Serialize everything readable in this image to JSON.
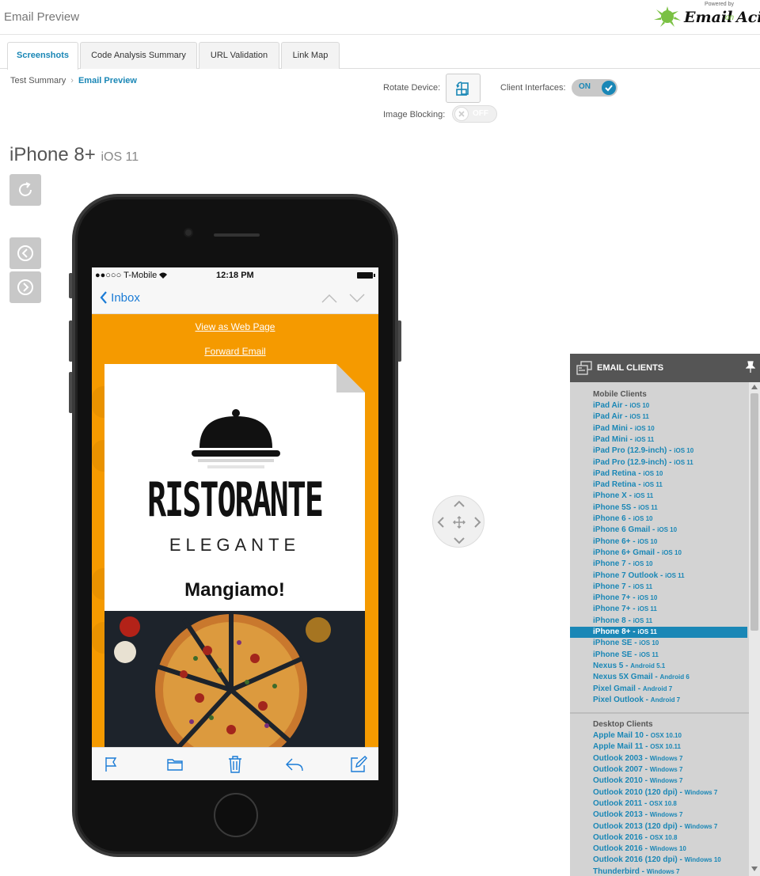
{
  "header": {
    "title": "Email Preview",
    "brand_powered": "Powered by",
    "brand_email": "Email",
    "brand_on": "on",
    "brand_acid": "Acid"
  },
  "tabs": [
    {
      "label": "Screenshots",
      "active": true
    },
    {
      "label": "Code Analysis Summary",
      "active": false
    },
    {
      "label": "URL Validation",
      "active": false
    },
    {
      "label": "Link Map",
      "active": false
    }
  ],
  "breadcrumb": {
    "parent": "Test Summary",
    "current": "Email Preview"
  },
  "controls": {
    "rotate_label": "Rotate Device:",
    "client_interfaces_label": "Client Interfaces:",
    "client_interfaces_state": "ON",
    "image_blocking_label": "Image Blocking:",
    "image_blocking_state": "OFF"
  },
  "device": {
    "name": "iPhone 8+",
    "os": "iOS 11"
  },
  "phone": {
    "carrier": "●●○○○ T-Mobile",
    "time": "12:18 PM",
    "back_label": "Inbox",
    "view_web": "View as Web Page",
    "forward": "Forward Email",
    "brand_main": "RISTORANTE",
    "brand_sub": "ELEGANTE",
    "headline": "Mangiamo!"
  },
  "panel": {
    "title": "EMAIL CLIENTS",
    "mobile_header": "Mobile Clients",
    "desktop_header": "Desktop Clients",
    "mobile": [
      {
        "name": "iPad Air",
        "os": "iOS 10"
      },
      {
        "name": "iPad Air",
        "os": "iOS 11"
      },
      {
        "name": "iPad Mini",
        "os": "iOS 10"
      },
      {
        "name": "iPad Mini",
        "os": "iOS 11"
      },
      {
        "name": "iPad Pro (12.9-inch)",
        "os": "iOS 10"
      },
      {
        "name": "iPad Pro (12.9-inch)",
        "os": "iOS 11"
      },
      {
        "name": "iPad Retina",
        "os": "iOS 10"
      },
      {
        "name": "iPad Retina",
        "os": "iOS 11"
      },
      {
        "name": "iPhone X",
        "os": "iOS 11"
      },
      {
        "name": "iPhone 5S",
        "os": "iOS 11"
      },
      {
        "name": "iPhone 6",
        "os": "iOS 10"
      },
      {
        "name": "iPhone 6 Gmail",
        "os": "iOS 10"
      },
      {
        "name": "iPhone 6+",
        "os": "iOS 10"
      },
      {
        "name": "iPhone 6+ Gmail",
        "os": "iOS 10"
      },
      {
        "name": "iPhone 7",
        "os": "iOS 10"
      },
      {
        "name": "iPhone 7 Outlook",
        "os": "iOS 11"
      },
      {
        "name": "iPhone 7",
        "os": "iOS 11"
      },
      {
        "name": "iPhone 7+",
        "os": "iOS 10"
      },
      {
        "name": "iPhone 7+",
        "os": "iOS 11"
      },
      {
        "name": "iPhone 8",
        "os": "iOS 11"
      },
      {
        "name": "iPhone 8+",
        "os": "iOS 11",
        "selected": true
      },
      {
        "name": "iPhone SE",
        "os": "iOS 10"
      },
      {
        "name": "iPhone SE",
        "os": "iOS 11"
      },
      {
        "name": "Nexus 5",
        "os": "Android 5.1"
      },
      {
        "name": "Nexus 5X Gmail",
        "os": "Android 6"
      },
      {
        "name": "Pixel Gmail",
        "os": "Android 7"
      },
      {
        "name": "Pixel Outlook",
        "os": "Android 7"
      }
    ],
    "desktop": [
      {
        "name": "Apple Mail 10",
        "os": "OSX 10.10"
      },
      {
        "name": "Apple Mail 11",
        "os": "OSX 10.11"
      },
      {
        "name": "Outlook 2003",
        "os": "Windows 7"
      },
      {
        "name": "Outlook 2007",
        "os": "Windows 7"
      },
      {
        "name": "Outlook 2010",
        "os": "Windows 7"
      },
      {
        "name": "Outlook 2010 (120 dpi)",
        "os": "Windows 7"
      },
      {
        "name": "Outlook 2011",
        "os": "OSX 10.8"
      },
      {
        "name": "Outlook 2013",
        "os": "Windows 7"
      },
      {
        "name": "Outlook 2013 (120 dpi)",
        "os": "Windows 7"
      },
      {
        "name": "Outlook 2016",
        "os": "OSX 10.8"
      },
      {
        "name": "Outlook 2016",
        "os": "Windows 10"
      },
      {
        "name": "Outlook 2016 (120 dpi)",
        "os": "Windows 10"
      },
      {
        "name": "Thunderbird",
        "os": "Windows 7"
      }
    ]
  },
  "colors": {
    "accent": "#1a87b6",
    "email_background": "#f59a00",
    "panel_background": "#d3d3d3"
  }
}
